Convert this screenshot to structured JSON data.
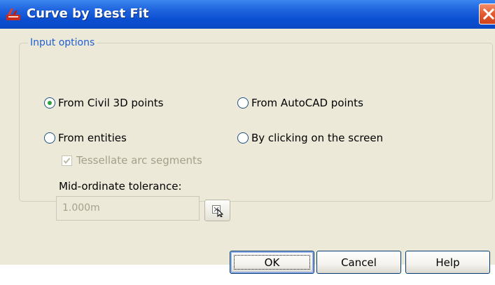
{
  "window": {
    "title": "Curve by Best Fit",
    "app_icon": "civil3d-app-icon",
    "close_icon": "close-x-icon"
  },
  "input_options": {
    "legend": "Input options",
    "radios": [
      {
        "label": "From Civil 3D points",
        "selected": true
      },
      {
        "label": "From AutoCAD points",
        "selected": false
      },
      {
        "label": "From entities",
        "selected": false
      },
      {
        "label": "By clicking on the screen",
        "selected": false
      }
    ],
    "tessellate": {
      "label": "Tessellate arc segments",
      "checked": true,
      "enabled": false
    },
    "tolerance": {
      "label": "Mid-ordinate tolerance:",
      "value": "1.000m",
      "enabled": false
    },
    "pick_icon": "pick-from-drawing-icon"
  },
  "buttons": {
    "ok": "OK",
    "cancel": "Cancel",
    "help": "Help"
  },
  "colors": {
    "title_bar": "#0a4fd0",
    "dialog_bg": "#ece9d8",
    "legend_text": "#1f5ed3",
    "radio_selected": "#2fa13a",
    "close_button": "#e35a2e"
  }
}
